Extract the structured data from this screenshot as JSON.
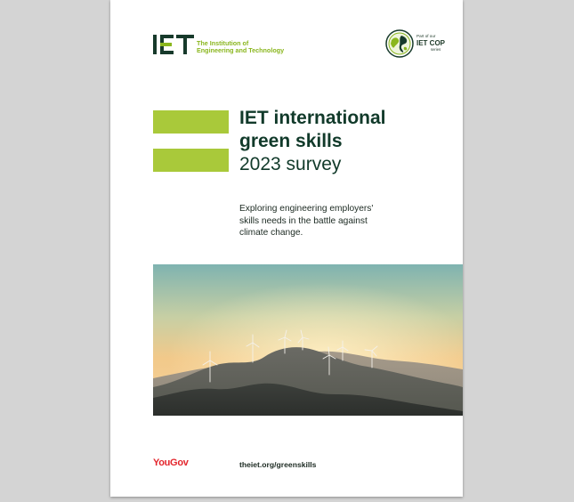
{
  "logo": {
    "mark": "IET",
    "name_line1": "The Institution of",
    "name_line2": "Engineering and Technology"
  },
  "badge": {
    "line1": "Part of our",
    "line2": "IET COP",
    "line3": "series"
  },
  "title": {
    "line1": "IET international",
    "line2": "green skills",
    "line3": "2023 survey"
  },
  "subtitle": "Exploring engineering employers' skills needs in the battle against climate change.",
  "photo": {
    "icon": "wind-turbines-mountains-image"
  },
  "footer": {
    "partner": "YouGov",
    "url": "theiet.org/greenskills"
  },
  "colors": {
    "accent_green": "#a9c93a",
    "logo_dark": "#173a2b",
    "logo_light_green": "#8ab61e",
    "title": "#113a2a",
    "yougov_red": "#e3262d"
  }
}
